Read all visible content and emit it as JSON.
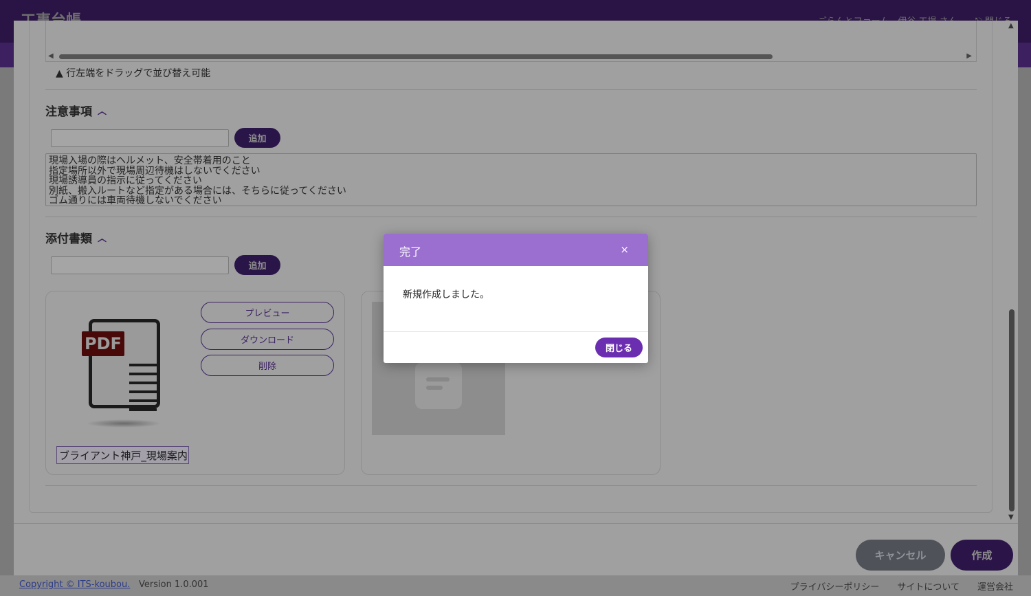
{
  "app": {
    "logo_text": "工事台帳",
    "header_right": "ごらんとファーム　伊谷 工場 さん　　⎋ 閉じる"
  },
  "footer": {
    "copyright": "Copyright © ITS-koubou.",
    "version": "Version 1.0.001",
    "links": [
      "プライバシーポリシー",
      "サイトについて",
      "運営会社"
    ]
  },
  "form": {
    "drag_note": "▲ 行左端をドラッグで並び替え可能",
    "notes_section": {
      "title": "注意事項",
      "input_value": "",
      "add_label": "追加",
      "lines": [
        "現場入場の際はヘルメット、安全帯着用のこと",
        "指定場所以外で現場周辺待機はしないでください",
        "現場誘導員の指示に従ってください",
        "別紙、搬入ルートなど指定がある場合には、そちらに従ってください",
        "ゴム通りには車両待機しないでください"
      ]
    },
    "attachments_section": {
      "title": "添付書類",
      "input_value": "",
      "add_label": "追加",
      "documents": [
        {
          "badge": "PDF",
          "name": "ブライアント神戸_現場案内",
          "actions": [
            "プレビュー",
            "ダウンロード",
            "削除"
          ]
        }
      ]
    },
    "cancel_label": "キャンセル",
    "create_label": "作成"
  },
  "dialog": {
    "title": "完了",
    "close_symbol": "×",
    "message": "新規作成しました。",
    "ok_label": "閉じる"
  },
  "colors": {
    "dialog_header": "#9a6fd0",
    "primary_button": "#6b2eb0",
    "cancel_button": "#4f5359"
  }
}
